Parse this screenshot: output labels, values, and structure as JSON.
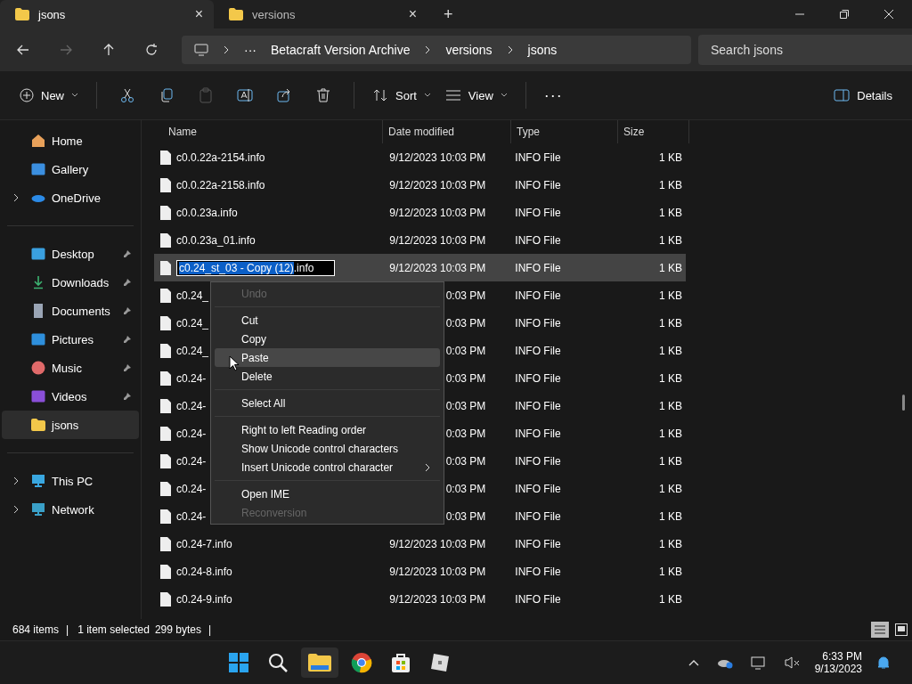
{
  "tabs": [
    {
      "title": "jsons",
      "selected": true,
      "close": "×"
    },
    {
      "title": "versions",
      "selected": false,
      "close": "×"
    }
  ],
  "new_tab": "+",
  "address": {
    "more": "···",
    "crumbs": [
      "Betacraft Version Archive",
      "versions",
      "jsons"
    ],
    "search_placeholder": "Search jsons"
  },
  "toolbar": {
    "new": "New",
    "sort": "Sort",
    "view": "View",
    "more": "···",
    "details": "Details"
  },
  "sidebar": {
    "groups": [
      [
        {
          "label": "Home",
          "expandable": false,
          "pinned": false,
          "selected": false
        },
        {
          "label": "Gallery",
          "expandable": false,
          "pinned": false,
          "selected": false
        },
        {
          "label": "OneDrive",
          "expandable": true,
          "pinned": false,
          "selected": false
        }
      ],
      [
        {
          "label": "Desktop",
          "expandable": false,
          "pinned": true,
          "selected": false
        },
        {
          "label": "Downloads",
          "expandable": false,
          "pinned": true,
          "selected": false
        },
        {
          "label": "Documents",
          "expandable": false,
          "pinned": true,
          "selected": false
        },
        {
          "label": "Pictures",
          "expandable": false,
          "pinned": true,
          "selected": false
        },
        {
          "label": "Music",
          "expandable": false,
          "pinned": true,
          "selected": false
        },
        {
          "label": "Videos",
          "expandable": false,
          "pinned": true,
          "selected": false
        },
        {
          "label": "jsons",
          "expandable": false,
          "pinned": false,
          "selected": true
        }
      ],
      [
        {
          "label": "This PC",
          "expandable": true,
          "pinned": false,
          "selected": false
        },
        {
          "label": "Network",
          "expandable": true,
          "pinned": false,
          "selected": false
        }
      ]
    ]
  },
  "table": {
    "columns": [
      "Name",
      "Date modified",
      "Type",
      "Size"
    ],
    "rows": [
      {
        "name": "c0.0.22a-2154.info",
        "date": "9/12/2023 10:03 PM",
        "type": "INFO File",
        "size": "1 KB",
        "selected": false
      },
      {
        "name": "c0.0.22a-2158.info",
        "date": "9/12/2023 10:03 PM",
        "type": "INFO File",
        "size": "1 KB",
        "selected": false
      },
      {
        "name": "c0.0.23a.info",
        "date": "9/12/2023 10:03 PM",
        "type": "INFO File",
        "size": "1 KB",
        "selected": false
      },
      {
        "name": "c0.0.23a_01.info",
        "date": "9/12/2023 10:03 PM",
        "type": "INFO File",
        "size": "1 KB",
        "selected": false
      },
      {
        "rename_selected": "c0.24_st_03 - Copy (12)",
        "rename_rest": ".info",
        "date": "9/12/2023 10:03 PM",
        "type": "INFO File",
        "size": "1 KB",
        "selected": true
      },
      {
        "name": "c0.24_",
        "date": "0:03 PM",
        "type": "INFO File",
        "size": "1 KB",
        "selected": false
      },
      {
        "name": "c0.24_",
        "date": "0:03 PM",
        "type": "INFO File",
        "size": "1 KB",
        "selected": false
      },
      {
        "name": "c0.24_",
        "date": "0:03 PM",
        "type": "INFO File",
        "size": "1 KB",
        "selected": false
      },
      {
        "name": "c0.24-",
        "date": "0:03 PM",
        "type": "INFO File",
        "size": "1 KB",
        "selected": false
      },
      {
        "name": "c0.24-",
        "date": "0:03 PM",
        "type": "INFO File",
        "size": "1 KB",
        "selected": false
      },
      {
        "name": "c0.24-",
        "date": "0:03 PM",
        "type": "INFO File",
        "size": "1 KB",
        "selected": false
      },
      {
        "name": "c0.24-",
        "date": "0:03 PM",
        "type": "INFO File",
        "size": "1 KB",
        "selected": false
      },
      {
        "name": "c0.24-",
        "date": "0:03 PM",
        "type": "INFO File",
        "size": "1 KB",
        "selected": false
      },
      {
        "name": "c0.24-",
        "date": "0:03 PM",
        "type": "INFO File",
        "size": "1 KB",
        "selected": false
      },
      {
        "name": "c0.24-7.info",
        "date": "9/12/2023 10:03 PM",
        "type": "INFO File",
        "size": "1 KB",
        "selected": false
      },
      {
        "name": "c0.24-8.info",
        "date": "9/12/2023 10:03 PM",
        "type": "INFO File",
        "size": "1 KB",
        "selected": false
      },
      {
        "name": "c0.24-9.info",
        "date": "9/12/2023 10:03 PM",
        "type": "INFO File",
        "size": "1 KB",
        "selected": false
      }
    ]
  },
  "context_menu": {
    "groups": [
      [
        {
          "label": "Undo",
          "disabled": true,
          "submenu": false,
          "hovered": false
        }
      ],
      [
        {
          "label": "Cut",
          "disabled": false,
          "submenu": false,
          "hovered": false
        },
        {
          "label": "Copy",
          "disabled": false,
          "submenu": false,
          "hovered": false
        },
        {
          "label": "Paste",
          "disabled": false,
          "submenu": false,
          "hovered": true
        },
        {
          "label": "Delete",
          "disabled": false,
          "submenu": false,
          "hovered": false
        }
      ],
      [
        {
          "label": "Select All",
          "disabled": false,
          "submenu": false,
          "hovered": false
        }
      ],
      [
        {
          "label": "Right to left Reading order",
          "disabled": false,
          "submenu": false,
          "hovered": false
        },
        {
          "label": "Show Unicode control characters",
          "disabled": false,
          "submenu": false,
          "hovered": false
        },
        {
          "label": "Insert Unicode control character",
          "disabled": false,
          "submenu": true,
          "hovered": false
        }
      ],
      [
        {
          "label": "Open IME",
          "disabled": false,
          "submenu": false,
          "hovered": false
        },
        {
          "label": "Reconversion",
          "disabled": true,
          "submenu": false,
          "hovered": false
        }
      ]
    ]
  },
  "status_bar": {
    "count": "684 items",
    "separator_1": "|",
    "selection": "1 item selected",
    "size": "299 bytes",
    "separator_2": "|"
  },
  "taskbar": {
    "time": "6:33 PM",
    "date": "9/13/2023"
  }
}
